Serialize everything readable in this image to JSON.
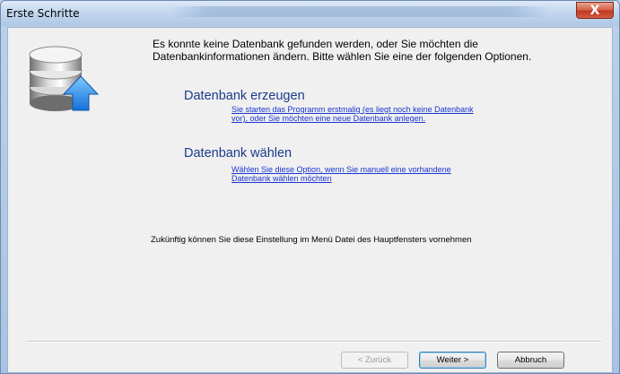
{
  "window": {
    "title": "Erste Schritte",
    "close_label": "X"
  },
  "intro_text": "Es konnte keine Datenbank gefunden werden, oder Sie möchten die Datenbankinformationen ändern. Bitte wählen Sie eine der folgenden Optionen.",
  "options": [
    {
      "title": "Datenbank erzeugen",
      "link_lines": [
        "Sie starten das Programm erstmalig (es liegt noch keine Datenbank",
        "vor), oder Sie möchten eine neue Datenbank anlegen."
      ]
    },
    {
      "title": "Datenbank wählen",
      "link_lines": [
        "Wählen Sie diese Option, wenn Sie manuell eine vorhandene",
        "Datenbank wählen möchten"
      ]
    }
  ],
  "hint_text": "Zukünftig können Sie diese Einstellung im Menü Datei des Hauptfensters vornehmen",
  "buttons": {
    "back": "< Zurück",
    "next": "Weiter >",
    "cancel": "Abbruch"
  },
  "icons": {
    "database": "database-icon",
    "arrow": "arrow-up-icon"
  },
  "colors": {
    "option_title": "#1b3a8c",
    "link": "#1a35d0",
    "close_button": "#c0391f"
  }
}
